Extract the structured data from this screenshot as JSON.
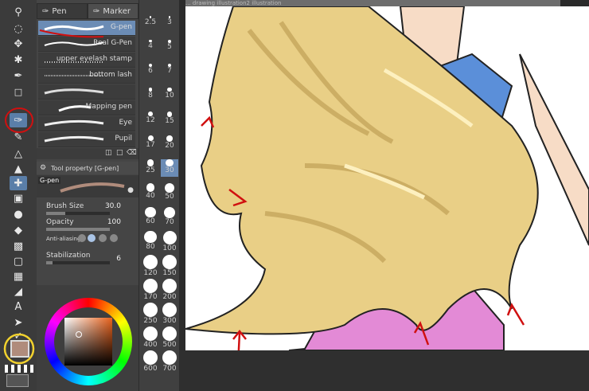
{
  "brush_panel": {
    "tabs": [
      "Pen",
      "Marker"
    ],
    "brushes": [
      "G-pen",
      "Real G-Pen",
      "upper eyelash stamp",
      "bottom lash",
      "Mapping pen",
      "Eye",
      "Pupil"
    ]
  },
  "tool_property": {
    "header": "Tool property [G-pen]",
    "preview_tag": "G-pen",
    "brush_size": {
      "label": "Brush Size",
      "value": "30.0",
      "fraction": 0.3
    },
    "opacity": {
      "label": "Opacity",
      "value": "100",
      "fraction": 1.0
    },
    "anti_alias": {
      "label": "Anti-aliasing"
    },
    "stabilization": {
      "label": "Stabilization",
      "value": "6"
    }
  },
  "brush_sizes": [
    "2.5",
    "3",
    "4",
    "5",
    "6",
    "7",
    "8",
    "10",
    "12",
    "15",
    "17",
    "20",
    "25",
    "30",
    "40",
    "50",
    "60",
    "70",
    "80",
    "100",
    "120",
    "150",
    "170",
    "200",
    "250",
    "300",
    "400",
    "500",
    "600",
    "700"
  ],
  "selected_size": "30",
  "canvas": {
    "tab_text": "... drawing   illustration2   illustration"
  },
  "colors": {
    "main_color": "#b08c7c",
    "accent": "#6b8cb5",
    "hair": "#e9cf86",
    "annotation_red": "#d01010",
    "annotation_yellow": "#f2d22e"
  },
  "icons": [
    "zoom-icon",
    "lasso-icon",
    "move-icon",
    "magic-wand-icon",
    "eyedropper-icon",
    "pen-icon",
    "pencil-icon",
    "brush-icon",
    "airbrush-icon",
    "decoration-icon",
    "eraser-icon",
    "blend-icon",
    "fill-icon",
    "gradient-icon",
    "shape-icon",
    "frame-icon",
    "ruler-icon",
    "text-icon",
    "balloon-icon",
    "line-correction-icon"
  ]
}
